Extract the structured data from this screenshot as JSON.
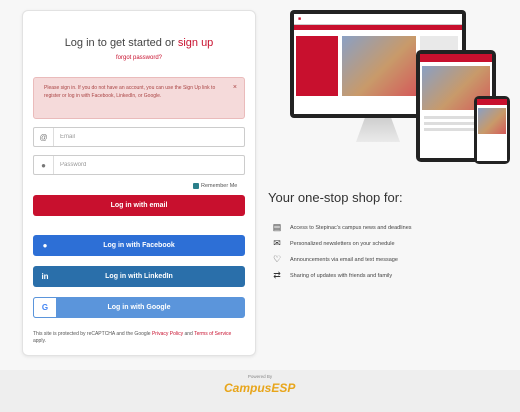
{
  "login": {
    "title_prefix": "Log in to get started or ",
    "title_link": "sign up",
    "forgot": "forgot password?",
    "alert": {
      "text": "Please sign in. If you do not have an account, you can use the Sign Up link to register or log in with Facebook, LinkedIn, or Google.",
      "close": "×"
    },
    "email_placeholder": "Email",
    "password_placeholder": "Password",
    "remember": "Remember Me",
    "email_button": "Log in with email",
    "facebook_button": "Log in with Facebook",
    "linkedin_button": "Log in with LinkedIn",
    "google_button": "Log in with Google",
    "recaptcha_prefix": "This site is protected by reCAPTCHA and the Google ",
    "privacy_link": "Privacy Policy",
    "recaptcha_and": " and ",
    "terms_link": "Terms of Service",
    "recaptcha_suffix": " apply."
  },
  "promo": {
    "title": "Your one-stop shop for:",
    "features": [
      {
        "icon": "news-icon",
        "text": "Access to Stepinac's campus news and deadlines"
      },
      {
        "icon": "mail-icon",
        "text": "Personalized newsletters on your schedule"
      },
      {
        "icon": "bell-icon",
        "text": "Announcements via email and text message"
      },
      {
        "icon": "share-icon",
        "text": "Sharing of updates with friends and family"
      }
    ]
  },
  "footer": {
    "powered": "Powered By",
    "logo": "CampusESP"
  },
  "colors": {
    "brand_red": "#c8102e",
    "facebook_blue": "#2d6fd6",
    "linkedin_blue": "#2a6faa",
    "google_blue": "#5b95db",
    "logo_gold": "#e8a51a"
  }
}
